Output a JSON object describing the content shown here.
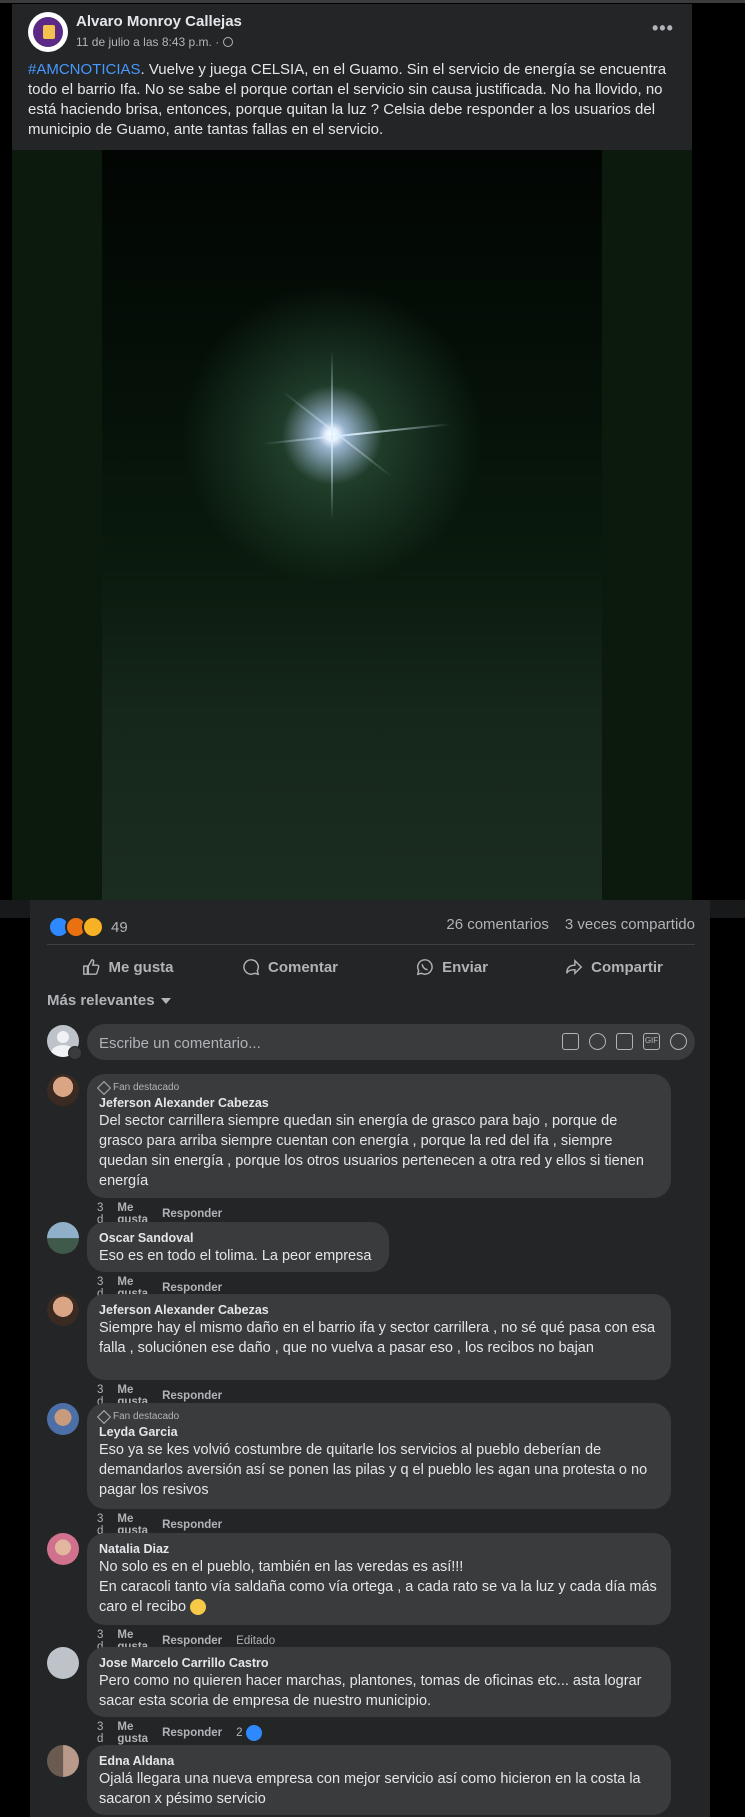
{
  "post": {
    "author": "Alvaro Monroy Callejas",
    "timestamp": "11 de julio a las 8:43 p.m. ·",
    "hashtag": "#AMCNOTICIAS",
    "text": ". Vuelve y juega CELSIA, en el Guamo. Sin el servicio de energía se encuentra todo el barrio Ifa. No se sabe el porque cortan el servicio sin causa justificada. No ha llovido, no está haciendo brisa, entonces, porque quitan la luz ?  Celsia debe responder a los usuarios del municipio de Guamo, ante tantas fallas en el servicio.",
    "more_icon": "ellipsis-icon"
  },
  "stats": {
    "reactions_count": "49",
    "comments": "26 comentarios",
    "shares": "3 veces compartido"
  },
  "actions": {
    "like": "Me gusta",
    "comment": "Comentar",
    "send": "Enviar",
    "share": "Compartir"
  },
  "sort": {
    "label": "Más relevantes"
  },
  "composer": {
    "placeholder": "Escribe un comentario..."
  },
  "comment_meta": {
    "like": "Me gusta",
    "reply": "Responder",
    "fan_badge": "Fan destacado",
    "edited": "Editado"
  },
  "comments": [
    {
      "name": "Jeferson Alexander Cabezas",
      "text": "Del sector carrillera siempre quedan sin energía de grasco para bajo , porque de grasco para arriba siempre cuentan con energía , porque la red del ifa , siempre quedan sin energía , porque los otros usuarios pertenecen a otra red y ellos si tienen energía",
      "time": "3 d"
    },
    {
      "name": "Oscar Sandoval",
      "text": "Eso es en todo el tolima. La peor empresa",
      "time": "3 d"
    },
    {
      "name": "Jeferson Alexander Cabezas",
      "text": "Siempre hay el mismo daño en el barrio ifa y sector carrillera , no sé qué pasa con esa falla , soluciónen ese daño , que no vuelva a pasar eso , los recibos no bajan",
      "time": "3 d"
    },
    {
      "name": "Leyda Garcia",
      "text": "Eso ya se kes volvió costumbre de quitarle los servicios al pueblo deberían de demandarlos aversión así se ponen las pilas y q el pueblo les agan una protesta o no pagar los resivos",
      "time": "3 d"
    },
    {
      "name": "Natalia Diaz",
      "text_line1": "No solo es en el pueblo, también en las veredas es así!!!",
      "text_line2": "En caracoli tanto vía saldaña como vía ortega , a cada rato se va la luz y cada día más caro el recibo",
      "time": "3 d"
    },
    {
      "name": "Jose Marcelo Carrillo Castro",
      "text": "Pero como no quieren hacer marchas, plantones, tomas de oficinas etc... asta lograr sacar esta scoria de empresa de nuestro municipio.",
      "time": "3 d",
      "likes": "2"
    },
    {
      "name": "Edna Aldana",
      "text": "Ojalá llegara una nueva empresa con mejor servicio así como hicieron en la costa la sacaron x pésimo servicio"
    }
  ]
}
